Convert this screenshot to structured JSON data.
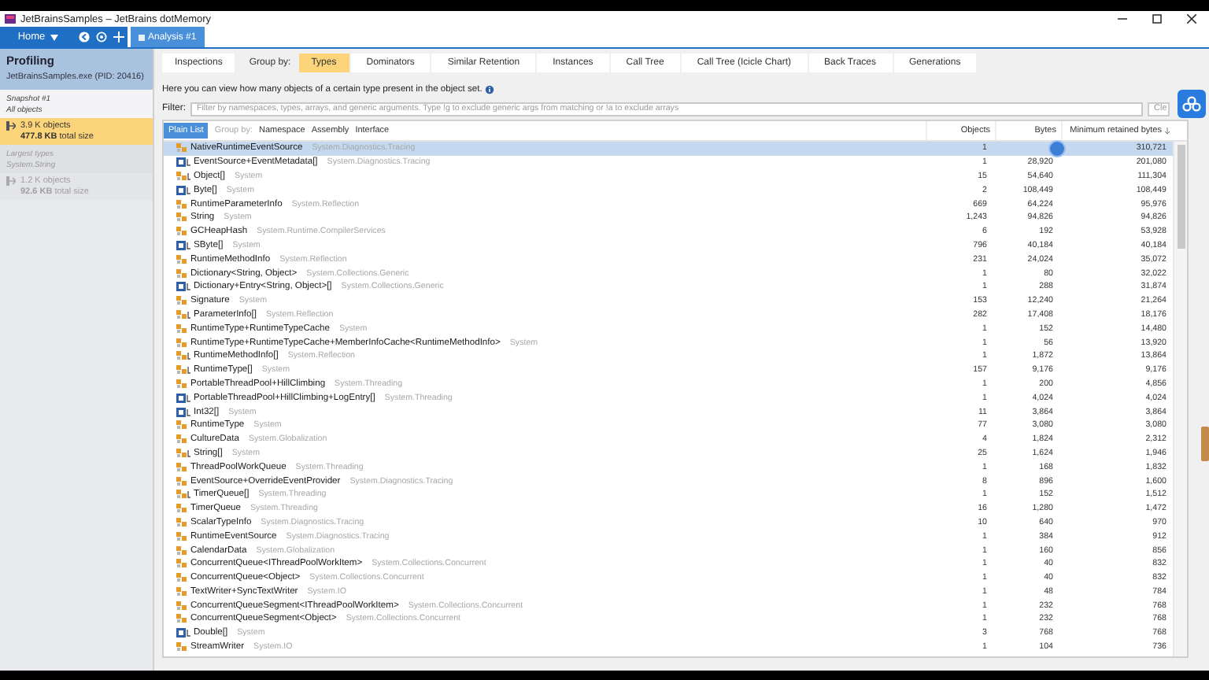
{
  "window": {
    "title": "JetBrainsSamples – JetBrains dotMemory"
  },
  "toolbar": {
    "home": "Home",
    "tabs": [
      {
        "label": "Analysis #1",
        "selected": true
      }
    ]
  },
  "sidebar": {
    "title": "Profiling",
    "process": "JetBrainsSamples.exe (PID: 20416)",
    "sections": [
      {
        "heading": "Snapshot #1",
        "subheading": "All objects",
        "count": "3.9 K",
        "count_label": "objects",
        "size": "477.8 KB",
        "size_label": "total size",
        "selected": true
      },
      {
        "heading": "Largest types",
        "subheading": "System.String",
        "count": "1.2 K",
        "count_label": "objects",
        "size": "92.6 KB",
        "size_label": "total size",
        "selected": false
      }
    ]
  },
  "inspections": {
    "label": "Inspections",
    "selected": false
  },
  "group_by": {
    "label": "Group by:",
    "options": [
      {
        "label": "Types",
        "selected": true
      },
      {
        "label": "Dominators",
        "selected": false
      },
      {
        "label": "Similar Retention",
        "selected": false
      },
      {
        "label": "Instances",
        "selected": false
      },
      {
        "label": "Call Tree",
        "selected": false
      },
      {
        "label": "Call Tree (Icicle Chart)",
        "selected": false
      },
      {
        "label": "Back Traces",
        "selected": false
      },
      {
        "label": "Generations",
        "selected": false
      }
    ]
  },
  "description": "Here you can view how many objects of a certain type present in the object set.",
  "filter": {
    "label": "Filter:",
    "placeholder": "Filter by namespaces, types, arrays, and generic arguments. Type !g to exclude generic args from matching or !a to exclude arrays",
    "clear": "Cle"
  },
  "table": {
    "view_modes": [
      {
        "label": "Plain List",
        "selected": true
      }
    ],
    "group_by": {
      "label": "Group by:",
      "options": [
        "Namespace",
        "Assembly",
        "Interface"
      ]
    },
    "columns": [
      "Objects",
      "Bytes",
      "Minimum retained bytes"
    ],
    "rows": [
      {
        "name": "NativeRuntimeEventSource",
        "namespace": "System.Diagnostics.Tracing",
        "kind": "class",
        "objects": "1",
        "retained": "310,721",
        "selected": true
      },
      {
        "name": "EventSource+EventMetadata[]",
        "namespace": "System.Diagnostics.Tracing",
        "kind": "value-array",
        "objects": "1",
        "bytes": "28,920",
        "retained": "201,080",
        "selected": false
      },
      {
        "name": "Object[]",
        "namespace": "System",
        "kind": "ref-array",
        "objects": "15",
        "bytes": "54,640",
        "retained": "111,304",
        "selected": false
      },
      {
        "name": "Byte[]",
        "namespace": "System",
        "kind": "value-array",
        "objects": "2",
        "bytes": "108,449",
        "retained": "108,449",
        "selected": false
      },
      {
        "name": "RuntimeParameterInfo",
        "namespace": "System.Reflection",
        "kind": "class",
        "objects": "669",
        "bytes": "64,224",
        "retained": "95,976",
        "selected": false
      },
      {
        "name": "String",
        "namespace": "System",
        "kind": "class",
        "objects": "1,243",
        "bytes": "94,826",
        "retained": "94,826",
        "selected": false
      },
      {
        "name": "GCHeapHash",
        "namespace": "System.Runtime.CompilerServices",
        "kind": "class",
        "objects": "6",
        "bytes": "192",
        "retained": "53,928",
        "selected": false
      },
      {
        "name": "SByte[]",
        "namespace": "System",
        "kind": "value-array",
        "objects": "796",
        "bytes": "40,184",
        "retained": "40,184",
        "selected": false
      },
      {
        "name": "RuntimeMethodInfo",
        "namespace": "System.Reflection",
        "kind": "class",
        "objects": "231",
        "bytes": "24,024",
        "retained": "35,072",
        "selected": false
      },
      {
        "name": "Dictionary<String, Object>",
        "namespace": "System.Collections.Generic",
        "kind": "class",
        "objects": "1",
        "bytes": "80",
        "retained": "32,022",
        "selected": false
      },
      {
        "name": "Dictionary+Entry<String, Object>[]",
        "namespace": "System.Collections.Generic",
        "kind": "value-array",
        "objects": "1",
        "bytes": "288",
        "retained": "31,874",
        "selected": false
      },
      {
        "name": "Signature",
        "namespace": "System",
        "kind": "class",
        "objects": "153",
        "bytes": "12,240",
        "retained": "21,264",
        "selected": false
      },
      {
        "name": "ParameterInfo[]",
        "namespace": "System.Reflection",
        "kind": "ref-array",
        "objects": "282",
        "bytes": "17,408",
        "retained": "18,176",
        "selected": false
      },
      {
        "name": "RuntimeType+RuntimeTypeCache",
        "namespace": "System",
        "kind": "class",
        "objects": "1",
        "bytes": "152",
        "retained": "14,480",
        "selected": false
      },
      {
        "name": "RuntimeType+RuntimeTypeCache+MemberInfoCache<RuntimeMethodInfo>",
        "namespace": "System",
        "kind": "class",
        "objects": "1",
        "bytes": "56",
        "retained": "13,920",
        "selected": false
      },
      {
        "name": "RuntimeMethodInfo[]",
        "namespace": "System.Reflection",
        "kind": "ref-array",
        "objects": "1",
        "bytes": "1,872",
        "retained": "13,864",
        "selected": false
      },
      {
        "name": "RuntimeType[]",
        "namespace": "System",
        "kind": "ref-array",
        "objects": "157",
        "bytes": "9,176",
        "retained": "9,176",
        "selected": false
      },
      {
        "name": "PortableThreadPool+HillClimbing",
        "namespace": "System.Threading",
        "kind": "class",
        "objects": "1",
        "bytes": "200",
        "retained": "4,856",
        "selected": false
      },
      {
        "name": "PortableThreadPool+HillClimbing+LogEntry[]",
        "namespace": "System.Threading",
        "kind": "value-array",
        "objects": "1",
        "bytes": "4,024",
        "retained": "4,024",
        "selected": false
      },
      {
        "name": "Int32[]",
        "namespace": "System",
        "kind": "value-array",
        "objects": "11",
        "bytes": "3,864",
        "retained": "3,864",
        "selected": false
      },
      {
        "name": "RuntimeType",
        "namespace": "System",
        "kind": "class",
        "objects": "77",
        "bytes": "3,080",
        "retained": "3,080",
        "selected": false
      },
      {
        "name": "CultureData",
        "namespace": "System.Globalization",
        "kind": "class",
        "objects": "4",
        "bytes": "1,824",
        "retained": "2,312",
        "selected": false
      },
      {
        "name": "String[]",
        "namespace": "System",
        "kind": "ref-array",
        "objects": "25",
        "bytes": "1,624",
        "retained": "1,946",
        "selected": false
      },
      {
        "name": "ThreadPoolWorkQueue",
        "namespace": "System.Threading",
        "kind": "class",
        "objects": "1",
        "bytes": "168",
        "retained": "1,832",
        "selected": false
      },
      {
        "name": "EventSource+OverrideEventProvider",
        "namespace": "System.Diagnostics.Tracing",
        "kind": "class",
        "objects": "8",
        "bytes": "896",
        "retained": "1,600",
        "selected": false
      },
      {
        "name": "TimerQueue[]",
        "namespace": "System.Threading",
        "kind": "ref-array",
        "objects": "1",
        "bytes": "152",
        "retained": "1,512",
        "selected": false
      },
      {
        "name": "TimerQueue",
        "namespace": "System.Threading",
        "kind": "class",
        "objects": "16",
        "bytes": "1,280",
        "retained": "1,472",
        "selected": false
      },
      {
        "name": "ScalarTypeInfo",
        "namespace": "System.Diagnostics.Tracing",
        "kind": "class",
        "objects": "10",
        "bytes": "640",
        "retained": "970",
        "selected": false
      },
      {
        "name": "RuntimeEventSource",
        "namespace": "System.Diagnostics.Tracing",
        "kind": "class",
        "objects": "1",
        "bytes": "384",
        "retained": "912",
        "selected": false
      },
      {
        "name": "CalendarData",
        "namespace": "System.Globalization",
        "kind": "class",
        "objects": "1",
        "bytes": "160",
        "retained": "856",
        "selected": false
      },
      {
        "name": "ConcurrentQueue<IThreadPoolWorkItem>",
        "namespace": "System.Collections.Concurrent",
        "kind": "class",
        "objects": "1",
        "bytes": "40",
        "retained": "832",
        "selected": false
      },
      {
        "name": "ConcurrentQueue<Object>",
        "namespace": "System.Collections.Concurrent",
        "kind": "class",
        "objects": "1",
        "bytes": "40",
        "retained": "832",
        "selected": false
      },
      {
        "name": "TextWriter+SyncTextWriter",
        "namespace": "System.IO",
        "kind": "class",
        "objects": "1",
        "bytes": "48",
        "retained": "784",
        "selected": false
      },
      {
        "name": "ConcurrentQueueSegment<IThreadPoolWorkItem>",
        "namespace": "System.Collections.Concurrent",
        "kind": "class",
        "objects": "1",
        "bytes": "232",
        "retained": "768",
        "selected": false
      },
      {
        "name": "ConcurrentQueueSegment<Object>",
        "namespace": "System.Collections.Concurrent",
        "kind": "class",
        "objects": "1",
        "bytes": "232",
        "retained": "768",
        "selected": false
      },
      {
        "name": "Double[]",
        "namespace": "System",
        "kind": "value-array",
        "objects": "3",
        "bytes": "768",
        "retained": "768",
        "selected": false
      },
      {
        "name": "StreamWriter",
        "namespace": "System.IO",
        "kind": "class",
        "objects": "1",
        "bytes": "104",
        "retained": "736",
        "selected": false
      }
    ]
  }
}
